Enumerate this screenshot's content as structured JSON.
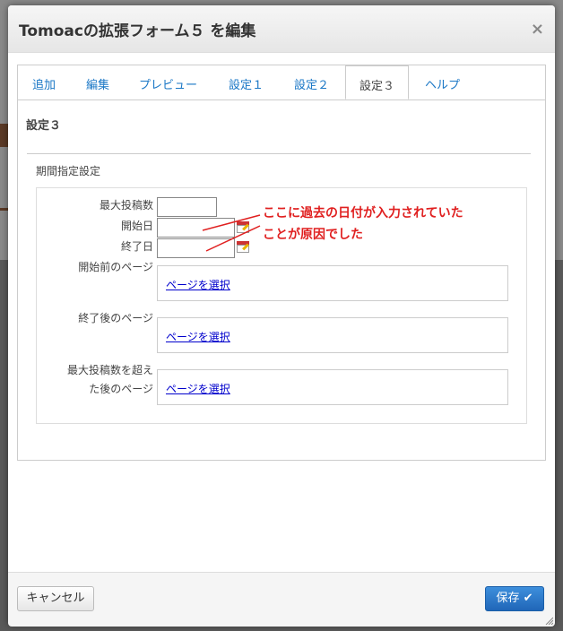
{
  "dialog": {
    "title": "Tomoacの拡張フォーム５ を編集",
    "close_glyph": "×"
  },
  "tabs": [
    {
      "label": "追加"
    },
    {
      "label": "編集"
    },
    {
      "label": "プレビュー"
    },
    {
      "label": "設定１"
    },
    {
      "label": "設定２"
    },
    {
      "label": "設定３",
      "active": true
    },
    {
      "label": "ヘルプ"
    }
  ],
  "section": {
    "title": "設定３",
    "legend": "期間指定設定"
  },
  "fields": {
    "max_posts_label": "最大投稿数",
    "max_posts_value": "",
    "start_date_label": "開始日",
    "start_date_value": "",
    "end_date_label": "終了日",
    "end_date_value": "",
    "before_page_label": "開始前のページ",
    "after_page_label": "終了後のページ",
    "over_max_label_1": "最大投稿数を超え",
    "over_max_label_2": "た後のページ",
    "select_page_link": "ページを選択"
  },
  "annotation": {
    "line1": "ここに過去の日付が入力されていた",
    "line2": "ことが原因でした",
    "color": "#e02020"
  },
  "footer": {
    "cancel_label": "キャンセル",
    "save_label": "保存 ✔"
  },
  "colors": {
    "tab_link": "#1a77c6",
    "save_button": "#2066b8"
  }
}
